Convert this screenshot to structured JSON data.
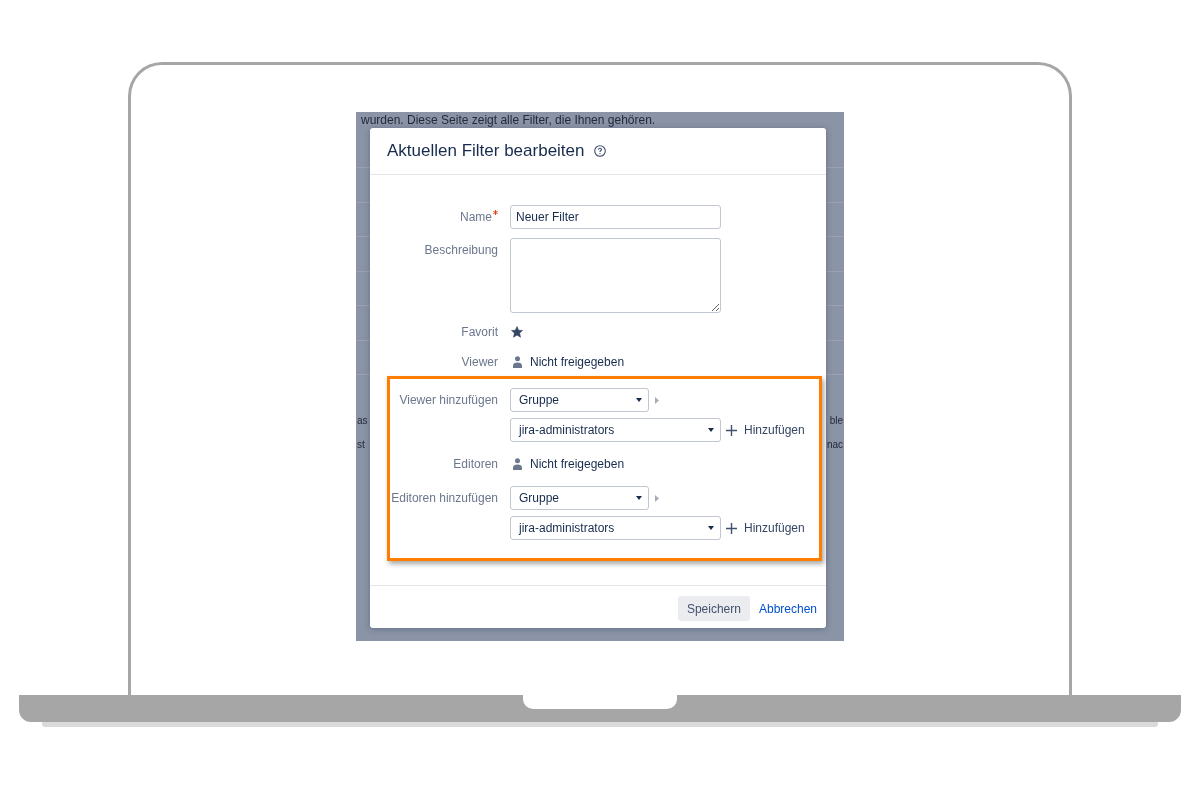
{
  "backdrop": {
    "notice": "wurden. Diese Seite zeigt alle Filter, die Ihnen gehören.",
    "fragments": [
      {
        "left": "as",
        "right": "ble"
      },
      {
        "left": "st",
        "right": "nac"
      }
    ]
  },
  "dialog": {
    "title": "Aktuellen Filter bearbeiten",
    "fields": [
      {
        "kind": "text",
        "label": "Name",
        "required": true,
        "highlighted": false,
        "value": "Neuer Filter"
      },
      {
        "kind": "textarea",
        "label": "Beschreibung",
        "required": false,
        "highlighted": false
      },
      {
        "kind": "favorite",
        "label": "Favorit",
        "required": false,
        "highlighted": false,
        "checked": true
      },
      {
        "kind": "share_status",
        "label": "Viewer",
        "required": false,
        "highlighted": false,
        "value": "Nicht freigegeben"
      },
      {
        "kind": "share_add",
        "label": "Viewer hinzufügen",
        "required": false,
        "highlighted": true,
        "type_select": "Gruppe",
        "group_select": "jira-administrators",
        "add_button": "Hinzufügen"
      },
      {
        "kind": "share_status",
        "label": "Editoren",
        "required": false,
        "highlighted": true,
        "value": "Nicht freigegeben"
      },
      {
        "kind": "share_add",
        "label": "Editoren hinzufügen",
        "required": false,
        "highlighted": true,
        "type_select": "Gruppe",
        "group_select": "jira-administrators",
        "add_button": "Hinzufügen"
      }
    ],
    "buttons": [
      {
        "kind": "button",
        "label": "Speichern"
      },
      {
        "kind": "link",
        "label": "Abbrechen"
      }
    ]
  }
}
